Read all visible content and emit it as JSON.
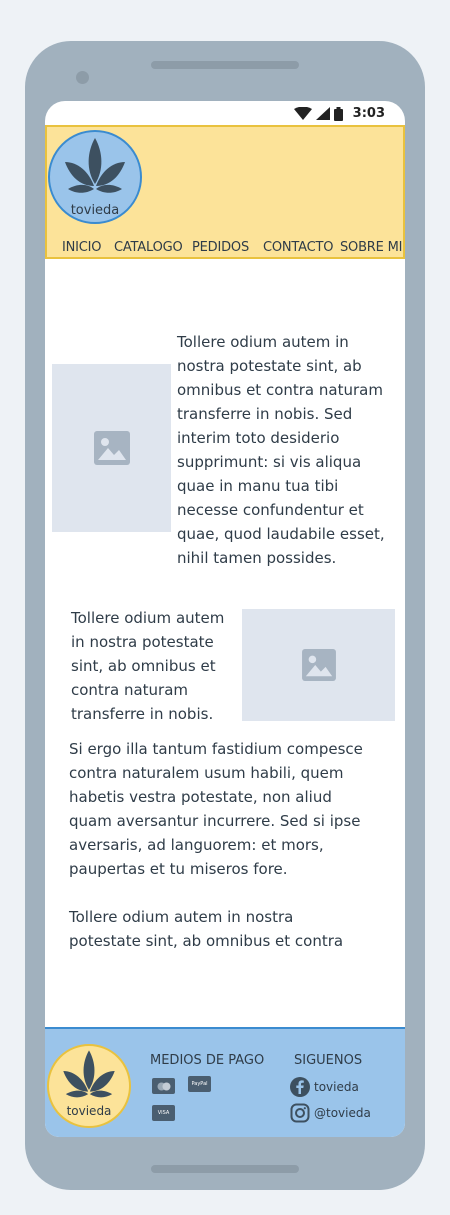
{
  "status_bar": {
    "time": "3:03"
  },
  "header": {
    "logo_text": "tovieda",
    "nav": [
      "INICIO",
      "CATALOGO",
      "PEDIDOS",
      "CONTACTO",
      "SOBRE MI"
    ]
  },
  "content": {
    "para1_lines": [
      "Tollere odium autem in",
      "nostra potestate sint, ab",
      "omnibus et contra naturam",
      "transferre in nobis. Sed",
      "interim toto desiderio",
      "supprimunt: si vis aliqua",
      "quae in manu tua tibi",
      "necesse confundentur et",
      "quae, quod laudabile esset,",
      "nihil tamen possides."
    ],
    "para2_lines": [
      "Tollere odium autem",
      "in nostra potestate",
      "sint, ab omnibus et",
      "contra naturam",
      "transferre in nobis."
    ],
    "para3_lines": [
      "Si ergo illa tantum fastidium compesce",
      "contra naturalem usum habili, quem",
      "habetis vestra potestate, non aliud",
      "quam aversantur incurrere. Sed si ipse",
      "aversaris, ad languorem: et mors,",
      "paupertas et tu miseros fore."
    ],
    "para4_lines": [
      "Tollere odium autem in nostra",
      "potestate sint, ab omnibus et contra"
    ]
  },
  "footer": {
    "logo_text": "tovieda",
    "payment_title": "MEDIOS DE PAGO",
    "payment_labels": {
      "paypal": "PayPal",
      "visa": "VISA"
    },
    "social_title": "SIGUENOS",
    "facebook": "tovieda",
    "instagram": "@tovieda"
  },
  "colors": {
    "header_bg": "#fce399",
    "footer_bg": "#9ac4ea",
    "text": "#2f3c48",
    "placeholder": "#dfe5ee",
    "phone_frame": "#a1b1be"
  }
}
